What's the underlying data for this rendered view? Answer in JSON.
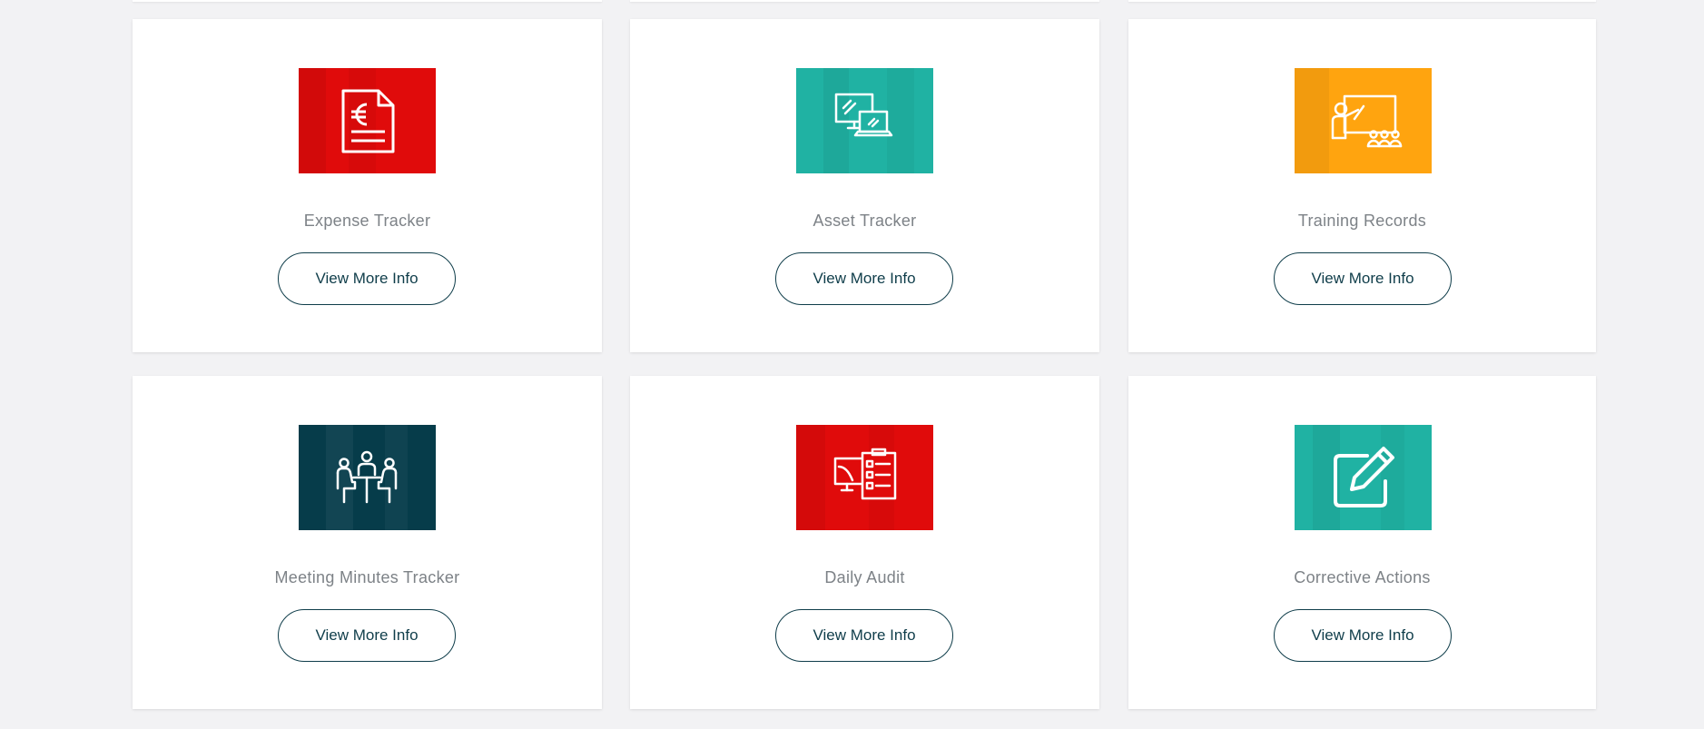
{
  "cards": [
    {
      "title": "Expense Tracker",
      "button": "View More Info",
      "icon": "euro-document-icon",
      "color": "#e00b0b"
    },
    {
      "title": "Asset Tracker",
      "button": "View More Info",
      "icon": "computer-devices-icon",
      "color": "#20b2a3"
    },
    {
      "title": "Training Records",
      "button": "View More Info",
      "icon": "presentation-icon",
      "color": "#ffa40f"
    },
    {
      "title": "Meeting Minutes Tracker",
      "button": "View More Info",
      "icon": "meeting-icon",
      "color": "#063c4a"
    },
    {
      "title": "Daily Audit",
      "button": "View More Info",
      "icon": "audit-checklist-icon",
      "color": "#e00b0b"
    },
    {
      "title": "Corrective Actions",
      "button": "View More Info",
      "icon": "edit-pencil-icon",
      "color": "#20b2a3"
    }
  ]
}
